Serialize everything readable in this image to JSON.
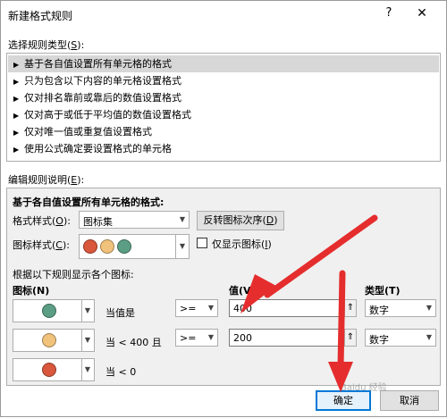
{
  "window": {
    "title": "新建格式规则",
    "help_label": "?",
    "close_label": "✕"
  },
  "rule_type": {
    "label": "选择规则类型(",
    "label_key": "S",
    "label_end": "):",
    "items": [
      {
        "label": "基于各自值设置所有单元格的格式",
        "selected": true
      },
      {
        "label": "只为包含以下内容的单元格设置格式",
        "selected": false
      },
      {
        "label": "仅对排名靠前或靠后的数值设置格式",
        "selected": false
      },
      {
        "label": "仅对高于或低于平均值的数值设置格式",
        "selected": false
      },
      {
        "label": "仅对唯一值或重复值设置格式",
        "selected": false
      },
      {
        "label": "使用公式确定要设置格式的单元格",
        "selected": false
      }
    ]
  },
  "rule_desc": {
    "label": "编辑规则说明(",
    "label_key": "E",
    "label_end": "):",
    "heading": "基于各自值设置所有单元格的格式:",
    "format_style_label": "格式样式(",
    "format_style_key": "O",
    "format_style_end": "):",
    "format_style_value": "图标集",
    "reverse_button": "反转图标次序(",
    "reverse_key": "D",
    "reverse_end": ")",
    "icon_style_label": "图标样式(",
    "icon_style_key": "C",
    "icon_style_end": "):",
    "show_icon_only_label": "仅显示图标(",
    "show_icon_only_key": "I",
    "show_icon_only_end": ")",
    "show_icon_only_checked": false,
    "rules_caption": "根据以下规则显示各个图标:",
    "col_icon": "图标(N)",
    "col_value": "值(V)",
    "col_type": "类型(T)",
    "rows": [
      {
        "icon_color": "#5b9e84",
        "condition": "当值是",
        "operator": ">=",
        "value": "400",
        "type": "数字"
      },
      {
        "icon_color": "#f0c27c",
        "condition": "当 < 400 且",
        "operator": ">=",
        "value": "200",
        "type": "数字"
      },
      {
        "icon_color": "#d9573c",
        "condition": "当 < 0"
      }
    ]
  },
  "icon_set_colors": [
    "#d9573c",
    "#f0c27c",
    "#5b9e84"
  ],
  "ok_button": "确定",
  "cancel_button": "取消",
  "annotation_color": "#e52d2d"
}
